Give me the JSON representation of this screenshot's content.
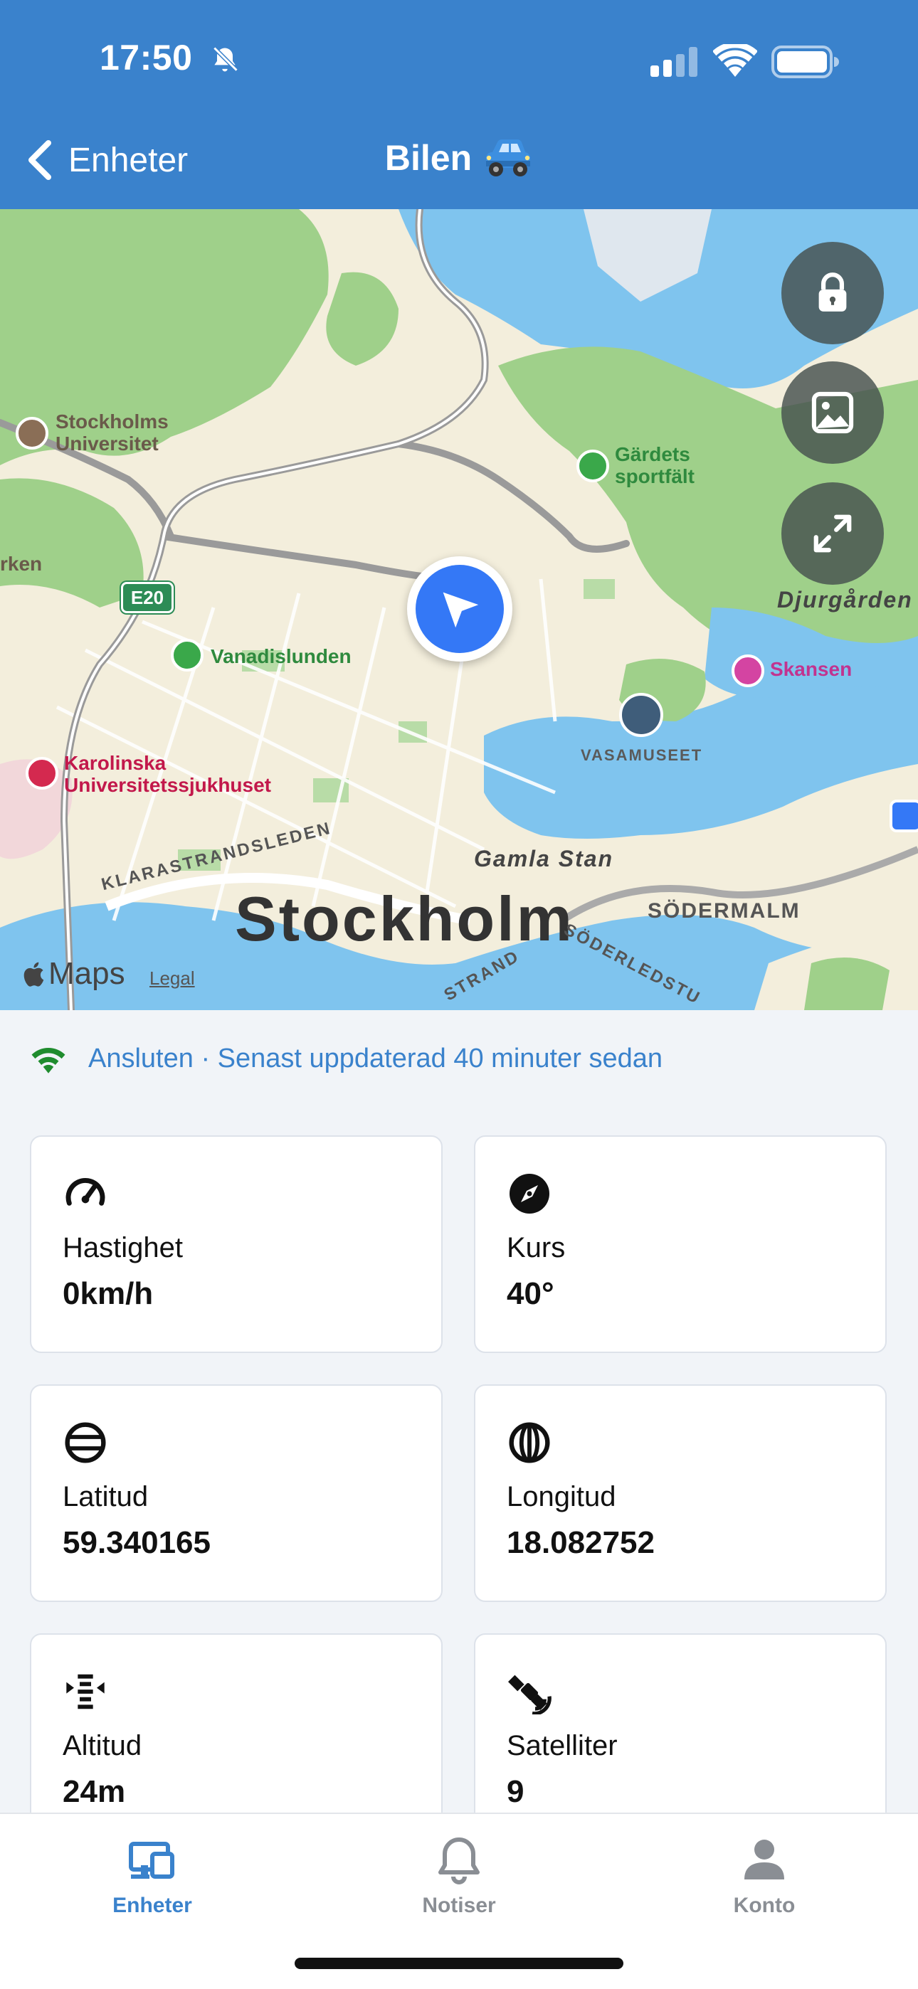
{
  "status_bar": {
    "time": "17:50",
    "icons": [
      "bell-slash-icon",
      "cellular-signal-icon",
      "wifi-icon",
      "battery-icon"
    ]
  },
  "nav": {
    "back_label": "Enheter",
    "title": "Bilen",
    "title_icon": "car-icon"
  },
  "map": {
    "labels": {
      "stockholms_universitet": "Stockholms\nUniversitet",
      "gardets": "Gärdets\nsportfält",
      "vanadislunden": "Vanadislunden",
      "djurgarden": "Djurgården",
      "skansen": "Skansen",
      "vasamuseet": "VASAMUSEET",
      "karolinska": "Karolinska\nUniversitetssjukhuset",
      "gamla_stan": "Gamla Stan",
      "klarastrandsleden": "KLARASTRANDSLEDEN",
      "stockholm": "Stockholm",
      "sodermalm": "SÖDERMALM",
      "soderledstunneln": "SÖDERLEDSTU",
      "strand": "STRAND",
      "rken": "rken",
      "e20": "E20"
    },
    "attribution": "Maps",
    "legal": "Legal",
    "buttons": [
      "lock-icon",
      "image-icon",
      "expand-icon"
    ],
    "colors": {
      "water": "#7fc4ee",
      "park": "#9fd08a",
      "urban": "#f3eedc",
      "marker": "#3478f6"
    }
  },
  "connection": {
    "text": "Ansluten · Senast uppdaterad 40 minuter sedan",
    "icon": "wifi-icon",
    "icon_color": "#1f8c2e"
  },
  "metrics": [
    {
      "icon": "speedometer-icon",
      "label": "Hastighet",
      "value": "0km/h"
    },
    {
      "icon": "compass-icon",
      "label": "Kurs",
      "value": "40°"
    },
    {
      "icon": "latitude-icon",
      "label": "Latitud",
      "value": "59.340165"
    },
    {
      "icon": "longitude-icon",
      "label": "Longitud",
      "value": "18.082752"
    },
    {
      "icon": "altitude-icon",
      "label": "Altitud",
      "value": "24m"
    },
    {
      "icon": "satellite-icon",
      "label": "Satelliter",
      "value": "9"
    }
  ],
  "tabs": [
    {
      "label": "Enheter",
      "icon": "devices-icon",
      "active": true
    },
    {
      "label": "Notiser",
      "icon": "bell-icon",
      "active": false
    },
    {
      "label": "Konto",
      "icon": "person-icon",
      "active": false
    }
  ],
  "theme": {
    "primary": "#3a82cc",
    "background": "#f1f4f8"
  }
}
